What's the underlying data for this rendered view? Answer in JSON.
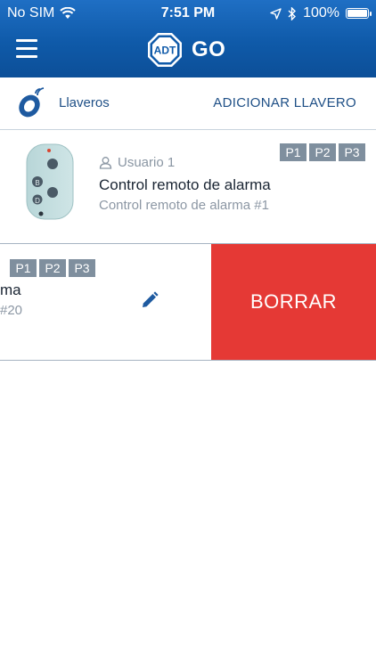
{
  "status": {
    "carrier": "No SIM",
    "time": "7:51 PM",
    "battery": "100%"
  },
  "header": {
    "logo_text": "ADT",
    "app_name": "GO"
  },
  "section": {
    "title": "Llaveros",
    "add_label": "ADICIONAR LLAVERO"
  },
  "fobs": [
    {
      "user": "Usuario 1",
      "name": "Control remoto de alarma",
      "detail": "Control remoto de alarma #1",
      "badges": [
        "P1",
        "P2",
        "P3"
      ]
    },
    {
      "name_partial": "ma",
      "detail_partial": "#20",
      "badges": [
        "P1",
        "P2",
        "P3"
      ],
      "delete_label": "BORRAR"
    }
  ],
  "colors": {
    "header_blue": "#0f5aa9",
    "delete_red": "#e53935",
    "badge_gray": "#7f8f9e",
    "link_blue": "#1e4f86"
  },
  "icons": {
    "wifi": "wifi-icon",
    "location": "location-arrow-icon",
    "bluetooth": "bluetooth-icon",
    "menu": "menu-icon",
    "fob": "keyfob-icon",
    "user": "user-icon",
    "edit": "pencil-icon"
  }
}
